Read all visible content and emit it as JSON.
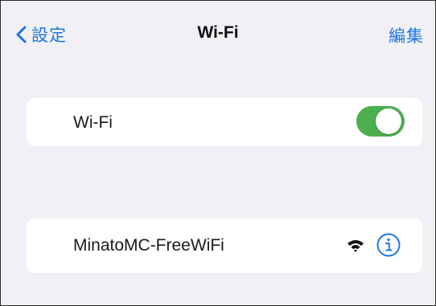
{
  "nav": {
    "back_label": "設定",
    "title": "Wi-Fi",
    "edit_label": "編集"
  },
  "wifi_toggle": {
    "label": "Wi-Fi",
    "state": "on"
  },
  "network": {
    "name": "MinatoMC-FreeWiFi",
    "signal_icon": "wifi-signal-icon",
    "info_icon": "info-icon"
  },
  "colors": {
    "accent": "#1d75e6",
    "toggle_on": "#4cae4f",
    "background": "#f1f1f5",
    "card": "#ffffff"
  }
}
